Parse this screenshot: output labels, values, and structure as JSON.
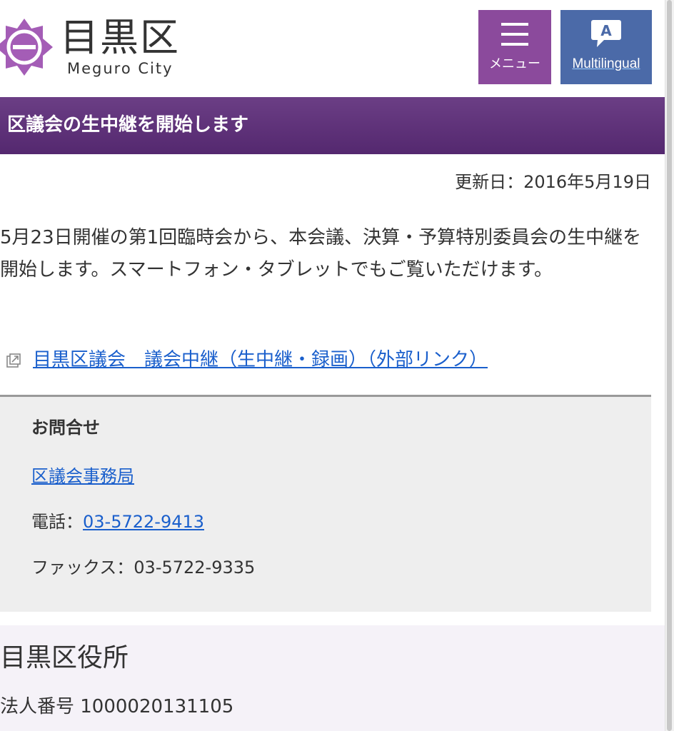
{
  "header": {
    "logo_text": "目黒区",
    "logo_sub": "Meguro City",
    "menu_label": "メニュー",
    "multilingual_label": "Multilingual"
  },
  "page": {
    "title": "区議会の生中継を開始します",
    "updated": "更新日：2016年5月19日",
    "body": "5月23日開催の第1回臨時会から、本会議、決算・予算特別委員会の生中継を開始します。スマートフォン・タブレットでもご覧いただけます。",
    "external_link": "目黒区議会　議会中継（生中継・録画）（外部リンク）"
  },
  "contact": {
    "title": "お問合せ",
    "department": "区議会事務局",
    "tel_label": "電話：",
    "tel_number": "03-5722-9413",
    "fax": "ファックス：03-5722-9335"
  },
  "footer": {
    "name": "目黒区役所",
    "corporate_number": "法人番号 1000020131105"
  },
  "colors": {
    "menu_button": "#8b4a9c",
    "multilingual_button": "#4b6aa8",
    "title_bar": "#5e3279",
    "link": "#1a5fcc",
    "contact_bg": "#eeeeee",
    "footer_bg": "#f5f2f8"
  },
  "icons": {
    "logo": "meguro-emblem-icon",
    "menu": "hamburger-icon",
    "multilingual": "speech-bubble-a-icon",
    "external": "external-link-icon"
  }
}
